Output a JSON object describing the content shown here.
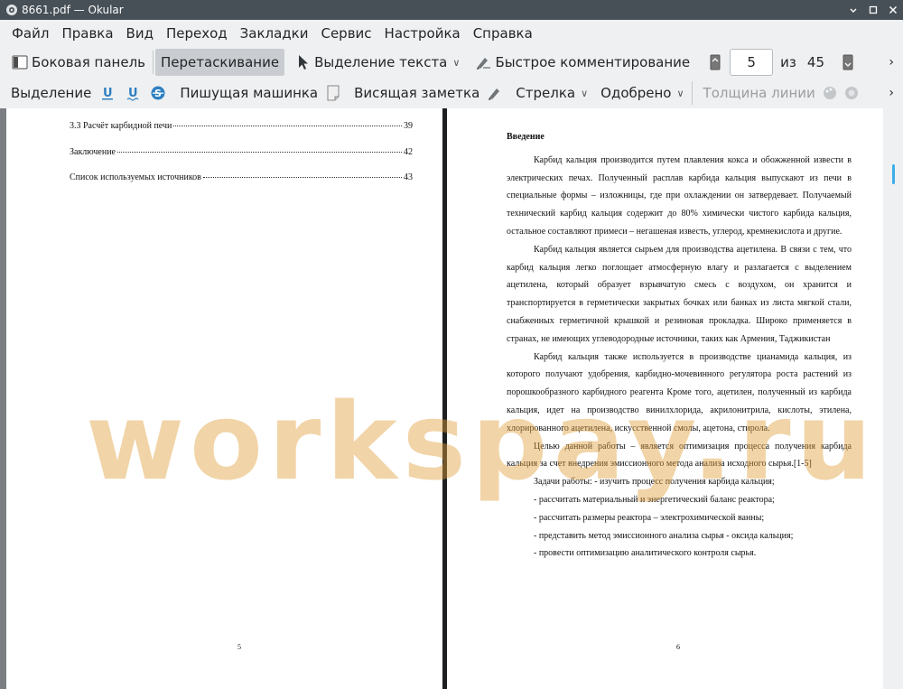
{
  "window": {
    "title": "8661.pdf  — Okular"
  },
  "menu": [
    "Файл",
    "Правка",
    "Вид",
    "Переход",
    "Закладки",
    "Сервис",
    "Настройка",
    "Справка"
  ],
  "toolbar1": {
    "sidebar": "Боковая панель",
    "drag": "Перетаскивание",
    "text_select": "Выделение текста",
    "quick_comment": "Быстрое комментирование",
    "page_current": "5",
    "page_of": "из",
    "page_total": "45"
  },
  "toolbar2": {
    "highlight": "Выделение",
    "typewriter": "Пишущая машинка",
    "sticky_note": "Висящая заметка",
    "arrow": "Стрелка",
    "stamp": "Одобрено",
    "line_width": "Толщина линии"
  },
  "left_page": {
    "toc": [
      {
        "title": "3.3 Расчёт карбидной печи",
        "page": "39"
      },
      {
        "title": "Заключение",
        "page": "42"
      },
      {
        "title": "Список используемых источников",
        "page": "43"
      }
    ],
    "page_number": "5"
  },
  "right_page": {
    "heading": "Введение",
    "paragraphs": [
      "Карбид кальция производится путем плавления кокса и обожженной извести в электрических печах. Полученный расплав карбида кальция выпускают из печи в специальные формы – изложницы, где при охлаждении он затвердевает.  Получаемый технический карбид кальция содержит до 80% химически чистого карбида кальция, остальное составляют примеси – негашеная известь, углерод, кремнекислота и другие.",
      "Карбид кальция является сырьем для производства ацетилена. В связи с тем, что карбид кальция легко поглощает атмосферную влагу и разлагается с выделением ацетилена, который образует взрывчатую смесь с воздухом, он хранится и транспортируется в герметически закрытых бочках или банках из листа мягкой стали, снабженных герметичной крышкой и резиновая прокладка. Широко применяется в странах, не имеющих углеводородные источники, таких как Армения, Таджикистан",
      "Карбид кальция также используется в производстве цианамида кальция, из которого получают удобрения, карбидно-мочевинного регулятора роста растений из порошкообразного карбидного реагента Кроме того, ацетилен, полученный из карбида кальция, идет на производство винилхлорида, акрилонитрила, кислоты, этилена, хлорированного ацетилена, искусственной смолы, ацетона, стирола.",
      "Целью данной работы – является оптимизация процесса получения карбида кальция за счет внедрения эмиссионного метода анализа исходного сырья.[1-5]"
    ],
    "tasks": [
      "Задачи работы: - изучить процесс получения карбида кальция;",
      "- рассчитать материальный и энергетический баланс реактора;",
      "- рассчитать размеры реактора – электрохимической ванны;",
      "- представить метод эмиссионного анализа сырья - оксида кальция;",
      "- провести оптимизацию аналитического контроля сырья."
    ],
    "page_number": "6"
  },
  "watermark": "workspay.ru",
  "colors": {
    "titlebar": "#475057",
    "window_bg": "#eff0f1",
    "active_button": "#c9cdd1",
    "doc_background": "#7b7f83",
    "watermark": "#e1a03c",
    "scroll_accent": "#3daee9"
  }
}
